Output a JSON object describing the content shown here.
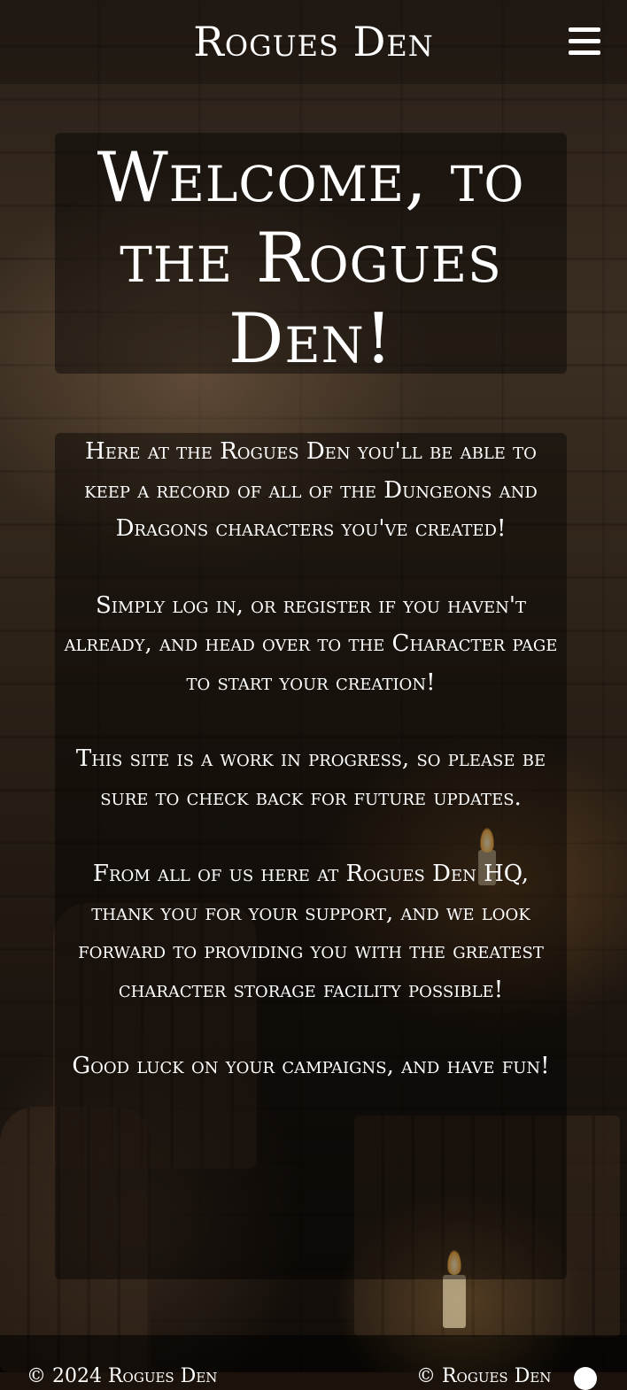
{
  "header": {
    "brand": "Rogues Den",
    "menu_icon": "hamburger-menu-icon"
  },
  "main": {
    "title": "Welcome, to the Rogues Den!",
    "paragraphs": [
      "Here at the Rogues Den you'll be able to keep a record of all of the Dungeons and Dragons characters you've created!",
      "Simply log in, or register if you haven't already, and head over to the Character page to start your creation!",
      "This site is a work in progress, so please be sure to check back for future updates.",
      "From all of us here at Rogues Den HQ, thank you for your support, and we look forward to providing you with the greatest character storage facility possible!",
      "Good luck on your campaigns, and have fun!"
    ]
  },
  "footer": {
    "copyright": "© 2024 Rogues Den",
    "credit": "© Rogues Den",
    "icon": "github-icon"
  },
  "colors": {
    "text": "#ffffff",
    "panel": "rgba(0,0,0,0.42)"
  }
}
